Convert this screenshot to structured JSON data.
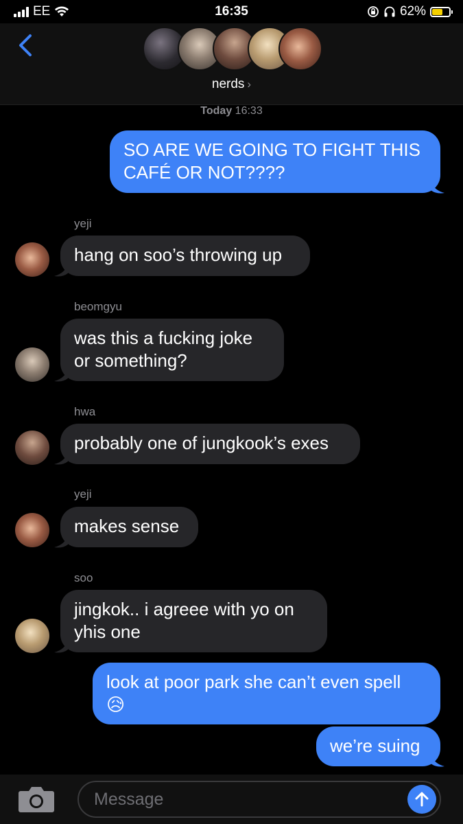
{
  "status_bar": {
    "carrier": "EE",
    "time": "16:35",
    "battery": "62%",
    "battery_level": 0.62,
    "icons": [
      "signal-bars-icon",
      "wifi-icon",
      "orientation-lock-icon",
      "headphones-icon",
      "battery-icon"
    ]
  },
  "header": {
    "group_name": "nerds",
    "chevron": "›",
    "avatars": [
      "avatar-1",
      "avatar-2",
      "avatar-3",
      "avatar-4",
      "avatar-5"
    ],
    "back_icon": "back-chevron-icon"
  },
  "timestamp": {
    "day": "Today",
    "time": "16:33"
  },
  "messages": [
    {
      "direction": "outgoing",
      "text": "SO ARE WE GOING TO FIGHT THIS\nCAFÉ OR NOT????"
    },
    {
      "direction": "incoming",
      "sender": "yeji",
      "text": "hang on soo’s throwing up"
    },
    {
      "direction": "incoming",
      "sender": "beomgyu",
      "text": "was this a fucking joke\nor something?"
    },
    {
      "direction": "incoming",
      "sender": "hwa",
      "text": "probably one of jungkook’s exes"
    },
    {
      "direction": "incoming",
      "sender": "yeji",
      "text": "makes sense"
    },
    {
      "direction": "incoming",
      "sender": "soo",
      "text": "jingkok.. i agreee with yo on\nyhis one"
    },
    {
      "direction": "outgoing",
      "text": "look at poor park she can’t even spell\n😥"
    },
    {
      "direction": "outgoing",
      "text": "we’re suing"
    }
  ],
  "input": {
    "placeholder": "Message",
    "camera_icon": "camera-icon",
    "send_icon": "send-arrow-icon"
  },
  "colors": {
    "outgoing_bubble": "#3e82f7",
    "incoming_bubble": "#262629",
    "background": "#000000",
    "accent": "#3e82f7"
  }
}
